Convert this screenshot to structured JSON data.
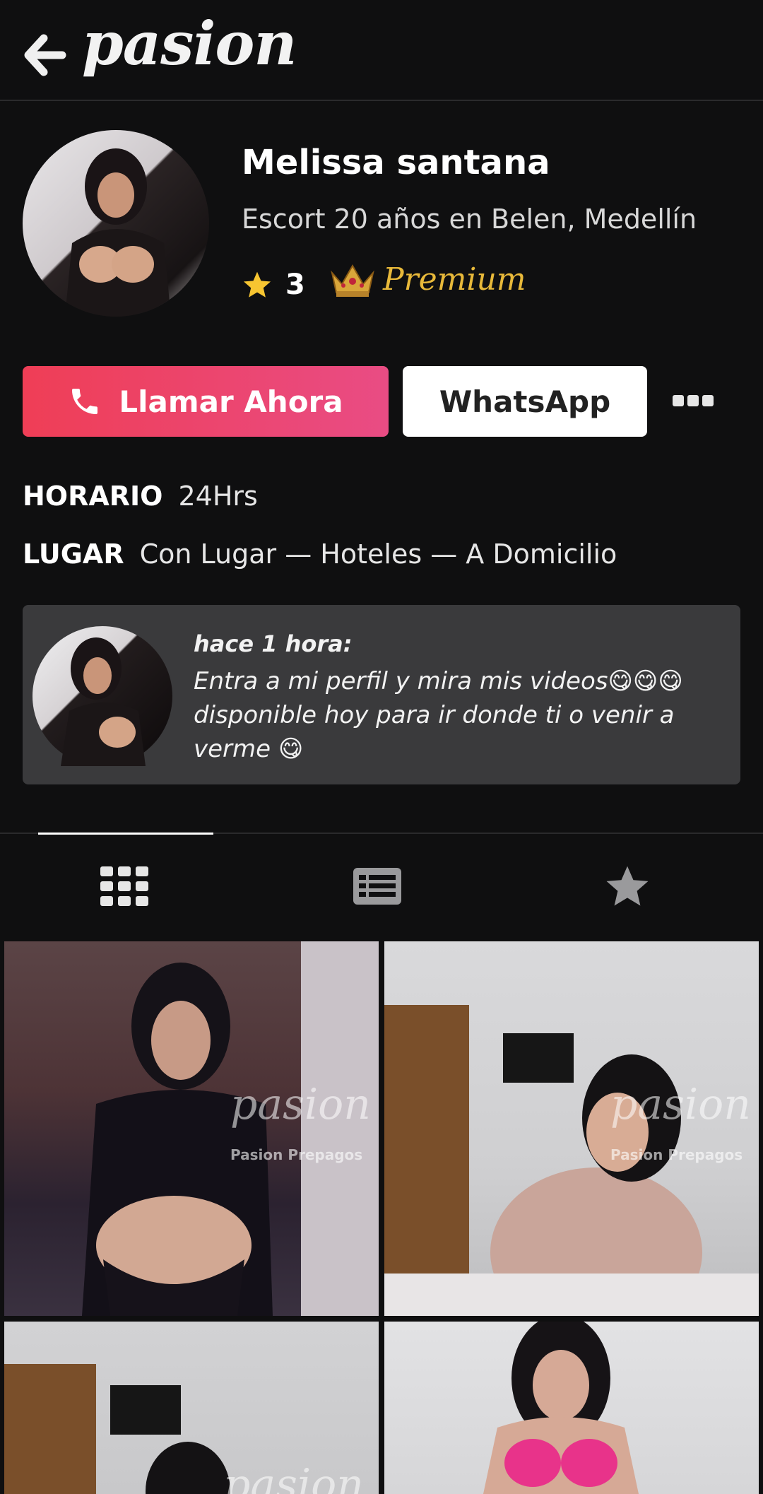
{
  "header": {
    "logo_text": "pasion"
  },
  "profile": {
    "name": "Melissa santana",
    "subtitle": "Escort 20 años en Belen, Medellín",
    "rating": "3",
    "badge": "Premium"
  },
  "actions": {
    "call_label": "Llamar Ahora",
    "whatsapp_label": "WhatsApp"
  },
  "info": {
    "horario_label": "HORARIO",
    "horario_value": "24Hrs",
    "lugar_label": "LUGAR",
    "lugar_value": "Con Lugar — Hoteles — A Domicilio"
  },
  "post": {
    "time": "hace 1 hora:",
    "text": "Entra a mi perfil y mira mis videos😋😋😋 disponible hoy para ir donde ti o venir a verme 😋"
  },
  "tabs": [
    "grid-icon",
    "list-icon",
    "star-icon"
  ],
  "watermark": {
    "logo": "pasion",
    "caption": "Pasion Prepagos"
  },
  "colors": {
    "background": "#0f0f10",
    "accent": "#ef3e56",
    "premium": "#e8b93a"
  }
}
